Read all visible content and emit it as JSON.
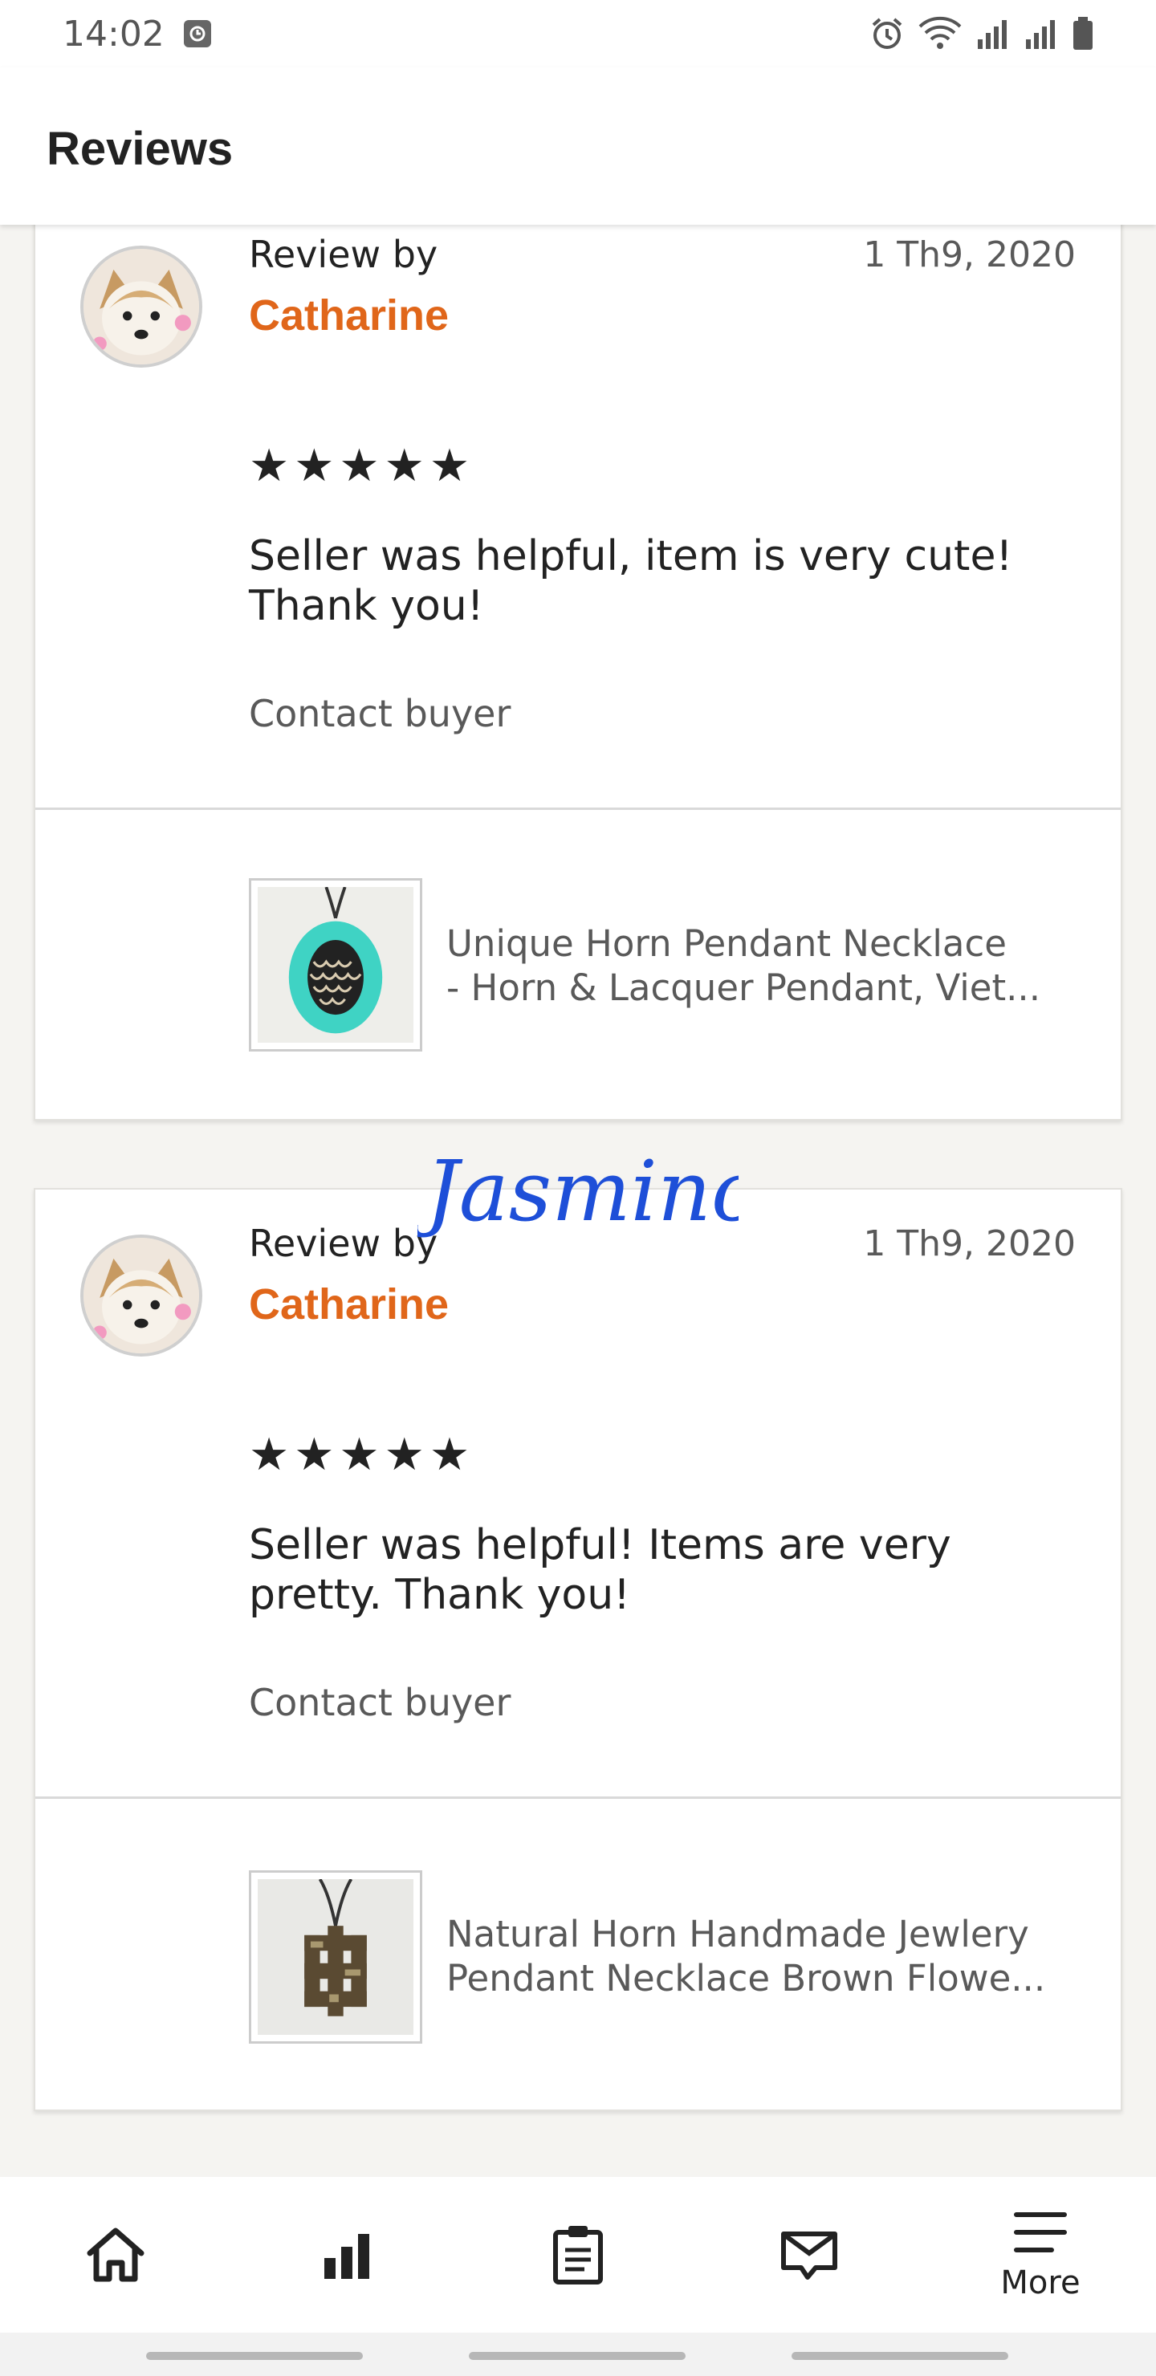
{
  "status_bar": {
    "time": "14:02"
  },
  "header": {
    "title": "Reviews"
  },
  "reviews": [
    {
      "review_by_label": "Review by",
      "reviewer": "Catharine",
      "date": "1 Th9, 2020",
      "rating": 5,
      "stars": "★★★★★",
      "text": "Seller was helpful, item is very cute! Thank you!",
      "contact_label": "Contact buyer",
      "listing_line1": "Unique Horn Pendant Necklace",
      "listing_line2": "- Horn & Lacquer Pendant, Viet..."
    },
    {
      "review_by_label": "Review by",
      "reviewer": "Catharine",
      "date": "1 Th9, 2020",
      "rating": 5,
      "stars": "★★★★★",
      "text": "Seller was helpful! Items are very pretty. Thank you!",
      "contact_label": "Contact buyer",
      "listing_line1": "Natural Horn Handmade Jewlery",
      "listing_line2": "Pendant Necklace Brown Flowe..."
    }
  ],
  "signature_text": "Jasmino",
  "bottom_nav": {
    "items": [
      {
        "icon": "home-icon"
      },
      {
        "icon": "stats-icon"
      },
      {
        "icon": "orders-icon"
      },
      {
        "icon": "messages-icon"
      },
      {
        "icon": "menu-icon",
        "label": "More"
      }
    ]
  },
  "colors": {
    "accent": "#e0661a",
    "signature": "#1e4fd8",
    "background": "#f5f4f1"
  }
}
